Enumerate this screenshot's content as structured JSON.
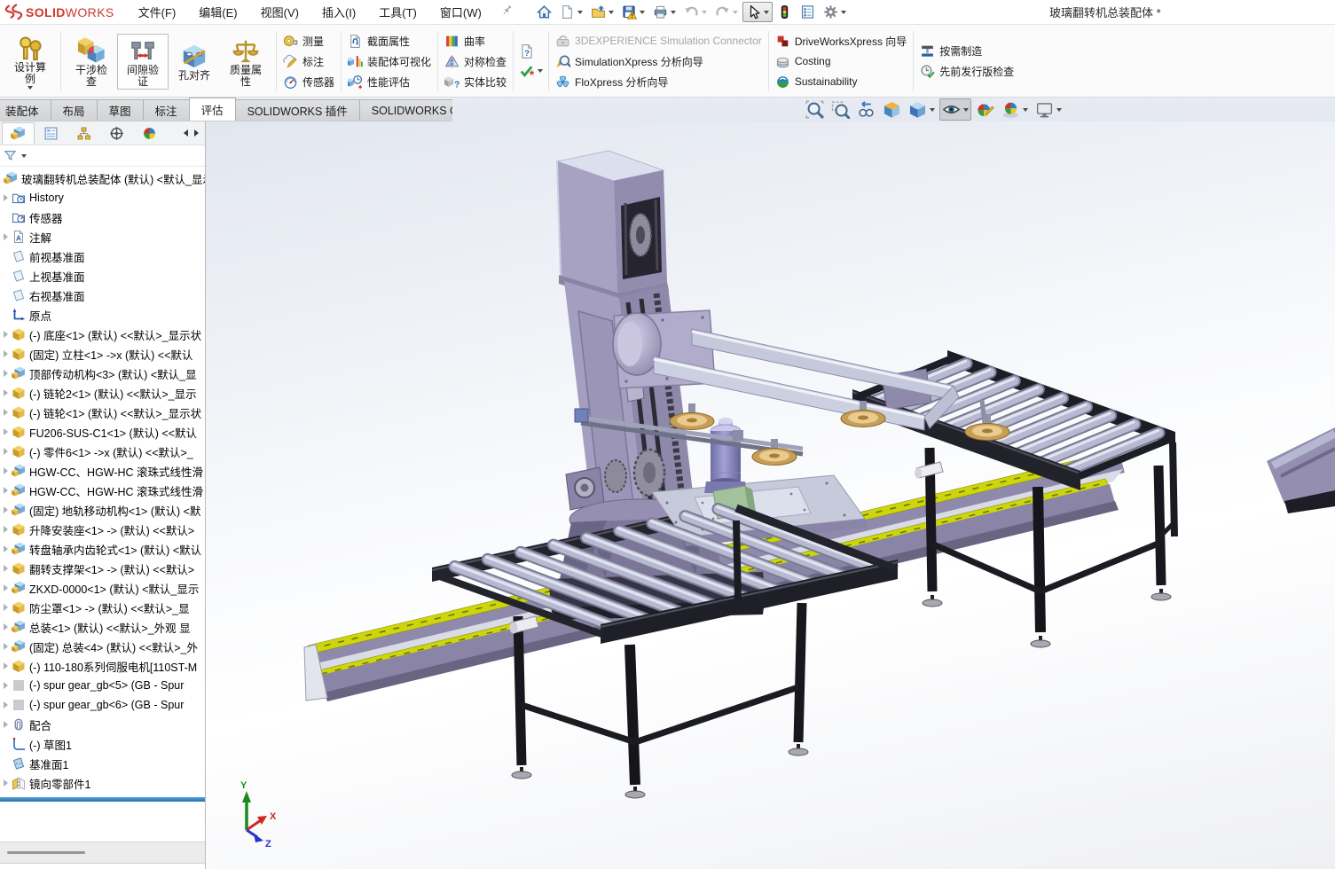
{
  "window": {
    "doc_title": "玻璃翻转机总装配体 *"
  },
  "brand": {
    "bold": "SOLID",
    "rest": "WORKS"
  },
  "menubar": {
    "items": [
      {
        "name": "menu-file",
        "label": "文件(F)"
      },
      {
        "name": "menu-edit",
        "label": "编辑(E)"
      },
      {
        "name": "menu-view",
        "label": "视图(V)"
      },
      {
        "name": "menu-insert",
        "label": "插入(I)"
      },
      {
        "name": "menu-tools",
        "label": "工具(T)"
      },
      {
        "name": "menu-window",
        "label": "窗口(W)"
      }
    ]
  },
  "quick_access": [
    {
      "icon": "home-icon"
    },
    {
      "icon": "new-document-icon",
      "dropdown": true
    },
    {
      "icon": "open-document-icon",
      "dropdown": true
    },
    {
      "icon": "save-icon",
      "dropdown": true
    },
    {
      "icon": "print-icon",
      "dropdown": true
    },
    {
      "icon": "undo-icon",
      "dropdown": true,
      "disabled": true
    },
    {
      "icon": "redo-icon",
      "dropdown": true,
      "disabled": true
    },
    {
      "icon": "select-tool-icon",
      "dropdown": true,
      "active": true
    },
    {
      "icon": "rebuild-icon"
    },
    {
      "icon": "file-properties-icon"
    },
    {
      "icon": "options-icon",
      "dropdown": true
    }
  ],
  "ribbon": {
    "groups": [
      {
        "type": "large",
        "items": [
          {
            "label": "设计算例",
            "icon": "design-study-icon",
            "dropdown": true
          }
        ]
      },
      {
        "type": "large",
        "items": [
          {
            "label": "干涉检查",
            "icon": "interference-check-icon"
          },
          {
            "label": "间隙验证",
            "icon": "clearance-verification-icon",
            "highlight": true
          },
          {
            "label": "孔对齐",
            "icon": "hole-alignment-icon"
          },
          {
            "label": "质量属性",
            "icon": "mass-properties-icon"
          }
        ]
      },
      {
        "type": "small",
        "items": [
          {
            "label": "测量",
            "icon": "measure-icon"
          },
          {
            "label": "标注",
            "icon": "markup-icon"
          },
          {
            "label": "传感器",
            "icon": "sensor-icon"
          }
        ]
      },
      {
        "type": "small",
        "items": [
          {
            "label": "截面属性",
            "icon": "section-properties-icon"
          },
          {
            "label": "装配体可视化",
            "icon": "assembly-visualization-icon"
          },
          {
            "label": "性能评估",
            "icon": "performance-evaluation-icon"
          }
        ]
      },
      {
        "type": "small",
        "items": [
          {
            "label": "曲率",
            "icon": "curvature-icon"
          },
          {
            "label": "对称检查",
            "icon": "symmetry-check-icon"
          },
          {
            "label": "实体比较",
            "icon": "compare-entities-icon"
          }
        ]
      },
      {
        "type": "stack",
        "items": [
          {
            "icon": "check-active-document-icon"
          },
          {
            "icon": "design-checker-icon",
            "dropdown": true
          }
        ]
      },
      {
        "type": "small",
        "items": [
          {
            "label": "3DEXPERIENCE Simulation Connector",
            "icon": "simulation-connector-icon",
            "disabled": true
          },
          {
            "label": "SimulationXpress 分析向导",
            "icon": "simulationxpress-icon"
          },
          {
            "label": "FloXpress 分析向导",
            "icon": "floxpress-icon"
          }
        ]
      },
      {
        "type": "small",
        "items": [
          {
            "label": "DriveWorksXpress 向导",
            "icon": "driveworksxpress-icon"
          },
          {
            "label": "Costing",
            "icon": "costing-icon"
          },
          {
            "label": "Sustainability",
            "icon": "sustainability-icon"
          }
        ]
      },
      {
        "type": "small",
        "items": [
          {
            "label": "按需制造",
            "icon": "manufacture-on-demand-icon"
          },
          {
            "label": "先前发行版检查",
            "icon": "previous-release-check-icon"
          }
        ]
      }
    ]
  },
  "tabs": {
    "items": [
      {
        "label": "装配体"
      },
      {
        "label": "布局"
      },
      {
        "label": "草图"
      },
      {
        "label": "标注"
      },
      {
        "label": "评估",
        "active": true
      },
      {
        "label": "SOLIDWORKS 插件"
      },
      {
        "label": "SOLIDWORKS CAM"
      }
    ]
  },
  "headsup": {
    "items": [
      {
        "icon": "zoom-fit-icon"
      },
      {
        "icon": "zoom-area-icon"
      },
      {
        "icon": "previous-view-icon"
      },
      {
        "icon": "section-view-icon"
      },
      {
        "icon": "display-style-icon",
        "dropdown": true
      },
      {
        "icon": "hide-show-items-icon",
        "dropdown": true,
        "active": true
      },
      {
        "icon": "edit-appearance-icon"
      },
      {
        "icon": "apply-scene-icon",
        "dropdown": true
      },
      {
        "icon": "view-settings-icon",
        "dropdown": true
      }
    ]
  },
  "panel": {
    "tabs": [
      {
        "icon": "featuremanager-tab-icon",
        "active": true
      },
      {
        "icon": "propertymanager-tab-icon"
      },
      {
        "icon": "configurationmanager-tab-icon"
      },
      {
        "icon": "dimxpertmanager-tab-icon"
      },
      {
        "icon": "displaymanager-tab-icon"
      }
    ],
    "filter_icon": "filter-funnel-icon"
  },
  "tree": {
    "root": {
      "icon": "assembly-icon",
      "label": "玻璃翻转机总装配体 (默认) <默认_显示"
    },
    "items": [
      {
        "arrow": true,
        "icon": "history-icon",
        "label": "History"
      },
      {
        "arrow": false,
        "icon": "sensors-folder-icon",
        "label": "传感器"
      },
      {
        "arrow": true,
        "icon": "annotations-icon",
        "label": "注解"
      },
      {
        "arrow": false,
        "icon": "plane-icon",
        "label": "前视基准面"
      },
      {
        "arrow": false,
        "icon": "plane-icon",
        "label": "上视基准面"
      },
      {
        "arrow": false,
        "icon": "plane-icon",
        "label": "右视基准面"
      },
      {
        "arrow": false,
        "icon": "origin-icon",
        "label": "原点"
      },
      {
        "arrow": true,
        "icon": "part-icon",
        "label": "(-) 底座<1> (默认) <<默认>_显示状"
      },
      {
        "arrow": true,
        "icon": "part-icon",
        "label": "(固定) 立柱<1> ->x (默认) <<默认"
      },
      {
        "arrow": true,
        "icon": "subassembly-icon",
        "label": "顶部传动机构<3> (默认) <默认_显"
      },
      {
        "arrow": true,
        "icon": "part-icon",
        "label": "(-) 链轮2<1> (默认) <<默认>_显示"
      },
      {
        "arrow": true,
        "icon": "part-icon",
        "label": "(-) 链轮<1> (默认) <<默认>_显示状"
      },
      {
        "arrow": true,
        "icon": "part-icon",
        "label": "FU206-SUS-C1<1> (默认) <<默认"
      },
      {
        "arrow": true,
        "icon": "part-icon",
        "label": "(-) 零件6<1> ->x (默认) <<默认>_"
      },
      {
        "arrow": true,
        "icon": "subassembly-icon",
        "label": "HGW-CC、HGW-HC 滚珠式线性滑"
      },
      {
        "arrow": true,
        "icon": "subassembly-icon",
        "label": "HGW-CC、HGW-HC 滚珠式线性滑"
      },
      {
        "arrow": true,
        "icon": "subassembly-icon",
        "label": "(固定) 地轨移动机构<1> (默认) <默"
      },
      {
        "arrow": true,
        "icon": "part-icon",
        "label": "升降安装座<1> -> (默认) <<默认>"
      },
      {
        "arrow": true,
        "icon": "subassembly-icon",
        "label": "转盘轴承内齿轮式<1> (默认) <默认"
      },
      {
        "arrow": true,
        "icon": "part-icon",
        "label": "翻转支撑架<1> -> (默认) <<默认>"
      },
      {
        "arrow": true,
        "icon": "subassembly-icon",
        "label": "ZKXD-0000<1> (默认) <默认_显示"
      },
      {
        "arrow": true,
        "icon": "part-icon",
        "label": "防尘罩<1> -> (默认) <<默认>_显"
      },
      {
        "arrow": true,
        "icon": "subassembly-icon",
        "label": "总装<1> (默认) <<默认>_外观 显"
      },
      {
        "arrow": true,
        "icon": "subassembly-icon",
        "label": "(固定) 总装<4> (默认) <<默认>_外"
      },
      {
        "arrow": true,
        "icon": "part-icon",
        "label": "(-) 110-180系列伺服电机[110ST-M"
      },
      {
        "arrow": true,
        "icon": "fastener-icon",
        "label": "(-) spur gear_gb<5> (GB - Spur"
      },
      {
        "arrow": true,
        "icon": "fastener-icon",
        "label": "(-) spur gear_gb<6> (GB - Spur"
      },
      {
        "arrow": true,
        "icon": "mates-icon",
        "label": "配合"
      },
      {
        "arrow": false,
        "icon": "sketch-icon",
        "label": "(-) 草图1"
      },
      {
        "arrow": false,
        "icon": "datum-plane-icon",
        "label": "基准面1"
      },
      {
        "arrow": true,
        "icon": "mirror-icon",
        "label": "镜向零部件1"
      }
    ]
  },
  "viewport": {
    "triad": {
      "x": "X",
      "y": "Y",
      "z": "Z"
    }
  },
  "colors": {
    "accent": "#1f6fb0",
    "rollback_bar": "#2e86c8",
    "logo_red": "#cf372b",
    "column_purple": "#a49ec0",
    "roller_lavender": "#b6b9d1",
    "rail_yellow": "#cdd60a",
    "frame_black": "#1d1d25",
    "suction_tan": "#c79e55"
  }
}
